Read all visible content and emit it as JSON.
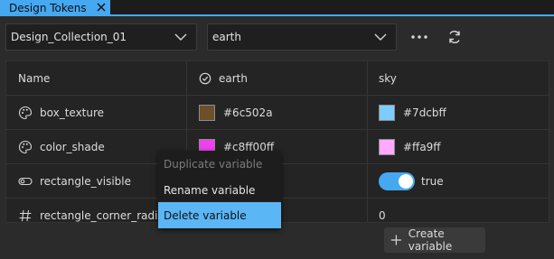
{
  "tab": {
    "label": "Design Tokens"
  },
  "toolbar": {
    "collection": "Design_Collection_01",
    "mode": "earth"
  },
  "table": {
    "headers": {
      "name": "Name",
      "col_earth": "earth",
      "col_sky": "sky"
    },
    "rows": [
      {
        "name": "box_texture",
        "icon": "palette-icon",
        "earth": "#6c502a",
        "earth_color": "#6c502a",
        "sky": "#7dcbff",
        "sky_color": "#7dcbff"
      },
      {
        "name": "color_shade",
        "icon": "palette-icon",
        "earth": "#c8ff00ff",
        "earth_color": "#f041f0",
        "sky": "#ffa9ff",
        "sky_color": "#ffa9ff"
      },
      {
        "name": "rectangle_visible",
        "icon": "toggle-icon",
        "sky": "true"
      },
      {
        "name": "rectangle_corner_radius",
        "icon": "hash-icon",
        "sky": "0"
      }
    ]
  },
  "context_menu": {
    "items": [
      {
        "label": "Duplicate variable",
        "state": "disabled"
      },
      {
        "label": "Rename variable",
        "state": "normal"
      },
      {
        "label": "Delete variable",
        "state": "highlighted"
      }
    ]
  },
  "footer": {
    "create_label": "Create variable"
  },
  "colors": {
    "accent": "#45a8f1",
    "menu_highlight": "#5bb6f6"
  }
}
